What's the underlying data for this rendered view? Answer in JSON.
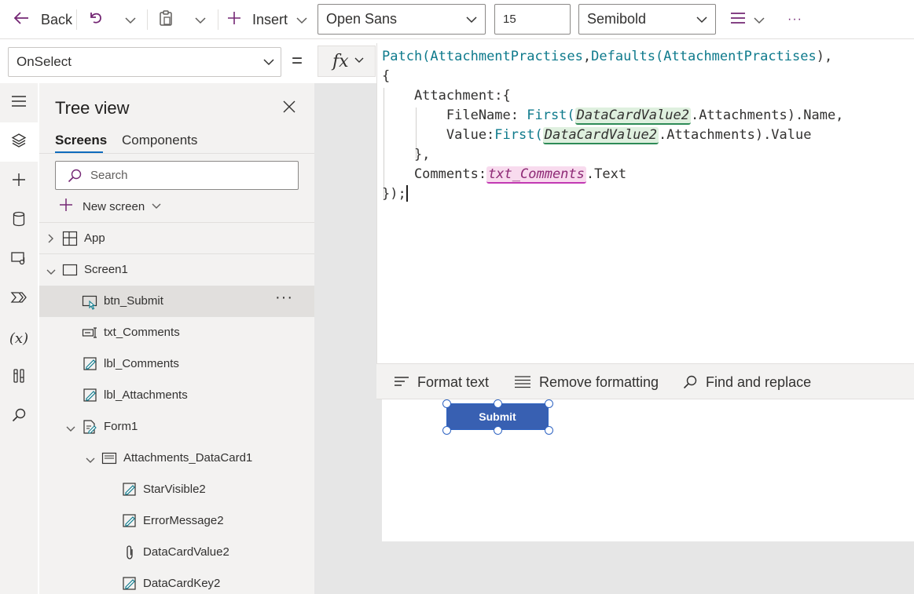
{
  "toolbar": {
    "back_label": "Back",
    "insert_label": "Insert",
    "font_family_value": "Open Sans",
    "font_size_value": "15",
    "font_weight_value": "Semibold",
    "more_label": "···"
  },
  "formula_bar": {
    "property_value": "OnSelect",
    "equals": "=",
    "fx_label": "fx"
  },
  "formula": {
    "lines": [
      [
        {
          "t": "Patch(",
          "c": "fn"
        },
        {
          "t": "AttachmentPractises",
          "c": "ds"
        },
        {
          "t": ",",
          "c": ""
        },
        {
          "t": "Defaults(",
          "c": "fn"
        },
        {
          "t": "AttachmentPractises",
          "c": "ds"
        },
        {
          "t": "),",
          "c": ""
        }
      ],
      [
        {
          "t": "{",
          "c": ""
        }
      ],
      [
        {
          "t": "    Attachment:{",
          "c": ""
        }
      ],
      [
        {
          "t": "        FileName: ",
          "c": ""
        },
        {
          "t": "First(",
          "c": "fn"
        },
        {
          "t": "DataCardValue2",
          "c": "ctl"
        },
        {
          "t": ".Attachments).Name,",
          "c": ""
        }
      ],
      [
        {
          "t": "        Value:",
          "c": ""
        },
        {
          "t": "First(",
          "c": "fn"
        },
        {
          "t": "DataCardValue2",
          "c": "ctl"
        },
        {
          "t": ".Attachments).Value",
          "c": ""
        }
      ],
      [
        {
          "t": "    },",
          "c": ""
        }
      ],
      [
        {
          "t": "    Comments:",
          "c": ""
        },
        {
          "t": "txt_Comments",
          "c": "ctl-pink"
        },
        {
          "t": ".Text",
          "c": ""
        }
      ],
      [
        {
          "t": "});",
          "c": ""
        }
      ]
    ]
  },
  "editor_footer": {
    "format_text": "Format text",
    "remove_formatting": "Remove formatting",
    "find_replace": "Find and replace"
  },
  "rail": {
    "variables_label": "(x)"
  },
  "tree": {
    "title": "Tree view",
    "tabs": [
      "Screens",
      "Components"
    ],
    "search_placeholder": "Search",
    "new_screen_label": "New screen",
    "nodes": {
      "app": "App",
      "screen1": "Screen1",
      "btn_submit": "btn_Submit",
      "txt_comments": "txt_Comments",
      "lbl_comments": "lbl_Comments",
      "lbl_attachments": "lbl_Attachments",
      "form1": "Form1",
      "attachments_datacard1": "Attachments_DataCard1",
      "starvisible2": "StarVisible2",
      "errormessage2": "ErrorMessage2",
      "datacardvalue2": "DataCardValue2",
      "datacardkey2": "DataCardKey2"
    },
    "more_label": "···"
  },
  "canvas": {
    "submit_label": "Submit"
  },
  "colors": {
    "accent": "#742774",
    "selection": "#2f64c2",
    "button": "#3860b2"
  }
}
